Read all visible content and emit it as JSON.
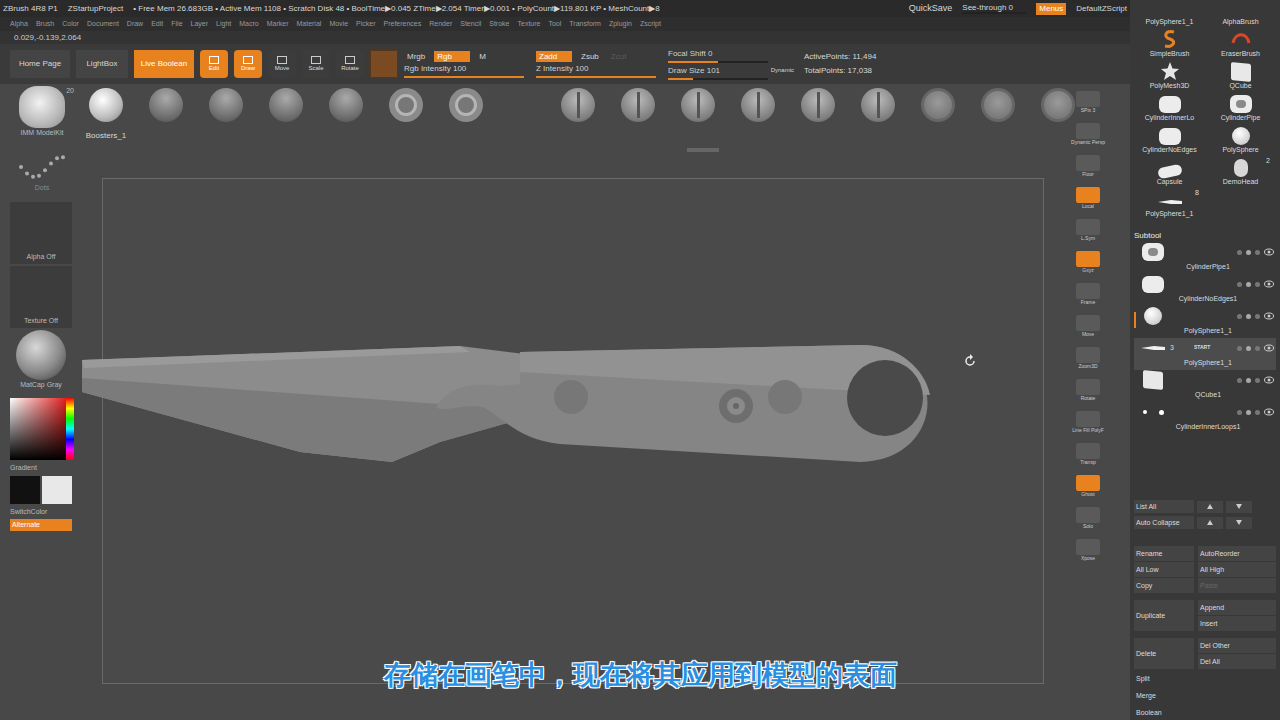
{
  "title_bar": {
    "app": "ZBrush 4R8 P1",
    "project": "ZStartupProject",
    "stats": "• Free Mem 26.683GB • Active Mem 1108 • Scratch Disk 48 • BoolTime▶0.045 ZTime▶2.054 Timer▶0.001 • PolyCount▶119.801 KP • MeshCount▶8",
    "quicksave": "QuickSave",
    "see_through": {
      "label": "See-through",
      "value": "0",
      "level": 0
    },
    "menus": {
      "label": "Menus",
      "on": true
    },
    "script": "DefaultZScript"
  },
  "menu": [
    "Alpha",
    "Brush",
    "Color",
    "Document",
    "Draw",
    "Edit",
    "File",
    "Layer",
    "Light",
    "Macro",
    "Marker",
    "Material",
    "Movie",
    "Picker",
    "Preferences",
    "Render",
    "Stencil",
    "Stroke",
    "Texture",
    "Tool",
    "Transform",
    "Zplugin",
    "Zscript"
  ],
  "coords": "0.029,-0.139,2.064",
  "shelf": {
    "home": "Home Page",
    "lightbox": "LightBox",
    "live_boolean": {
      "label": "Live Boolean",
      "on": true
    },
    "modes": [
      {
        "label": "Edit",
        "on": true
      },
      {
        "label": "Draw",
        "on": true
      },
      {
        "label": "Move",
        "on": false
      },
      {
        "label": "Scale",
        "on": false
      },
      {
        "label": "Rotate",
        "on": false
      }
    ],
    "color_modes": [
      {
        "label": "Mrgb",
        "on": false
      },
      {
        "label": "Rgb",
        "on": true
      },
      {
        "label": "M",
        "on": false
      }
    ],
    "rgb_intensity": {
      "label": "Rgb Intensity",
      "value": "100",
      "level": 1
    },
    "z_modes": [
      {
        "label": "Zadd",
        "on": true,
        "disabled": false
      },
      {
        "label": "Zsub",
        "on": false,
        "disabled": false
      },
      {
        "label": "Zcut",
        "on": false,
        "disabled": true
      }
    ],
    "z_intensity": {
      "label": "Z Intensity",
      "value": "100",
      "level": 1
    },
    "focal_shift": {
      "label": "Focal Shift",
      "value": "0",
      "level": 0.5
    },
    "draw_size": {
      "label": "Draw Size",
      "value": "101",
      "level": 0.25
    },
    "dynamic": "Dynamic",
    "active_points": "ActivePoints: 11,494",
    "total_points": "TotalPoints: 17,038"
  },
  "brush_shelf": {
    "label": "Boosters_1",
    "left_items": [
      {
        "kind": "ball"
      },
      {
        "kind": "stud"
      },
      {
        "kind": "stud"
      },
      {
        "kind": "stud"
      },
      {
        "kind": "stud"
      },
      {
        "kind": "ring"
      },
      {
        "kind": "ring"
      }
    ],
    "right_items": [
      {
        "kind": "screw"
      },
      {
        "kind": "screw"
      },
      {
        "kind": "screw"
      },
      {
        "kind": "screw"
      },
      {
        "kind": "screw"
      },
      {
        "kind": "screw"
      },
      {
        "kind": "disc"
      },
      {
        "kind": "disc"
      },
      {
        "kind": "disc"
      }
    ]
  },
  "left_panel": {
    "modelkit": {
      "label": "IMM ModelKit",
      "count": "20"
    },
    "stroke": "Dots",
    "alpha": "Alpha Off",
    "texture": "Texture Off",
    "material": "MatCap Gray",
    "gradient": "Gradient",
    "switch_color": "SwitchColor",
    "alternate": {
      "label": "Alternate",
      "on": true
    }
  },
  "right_shelf": [
    {
      "label": "SPix 3",
      "on": false
    },
    {
      "label": "Dynamic Persp",
      "on": false
    },
    {
      "label": "Floor",
      "on": false
    },
    {
      "label": "Local",
      "on": true
    },
    {
      "label": "L.Sym",
      "on": false
    },
    {
      "label": "Gxyz",
      "on": true
    },
    {
      "label": "Frame",
      "on": false
    },
    {
      "label": "Move",
      "on": false
    },
    {
      "label": "Zoom3D",
      "on": false
    },
    {
      "label": "Rotate",
      "on": false
    },
    {
      "label": "Line Fill PolyF",
      "on": false
    },
    {
      "label": "Transp",
      "on": false
    },
    {
      "label": "Ghost",
      "on": true
    },
    {
      "label": "Solo",
      "on": false
    },
    {
      "label": "Xpose",
      "on": false
    }
  ],
  "tools": [
    {
      "label": "PolySphere1_1",
      "kind": "none"
    },
    {
      "label": "AlphaBrush",
      "kind": "none"
    },
    {
      "label": "SimpleBrush",
      "kind": "brush"
    },
    {
      "label": "EraserBrush",
      "kind": "eraser"
    },
    {
      "label": "PolyMesh3D",
      "kind": "star"
    },
    {
      "label": "QCube",
      "kind": "cube"
    },
    {
      "label": "CylinderInnerLo",
      "kind": "cylinder"
    },
    {
      "label": "CylinderPipe",
      "kind": "pipe"
    },
    {
      "label": "CylinderNoEdges",
      "kind": "cylinder"
    },
    {
      "label": "PolySphere",
      "kind": "sphere"
    },
    {
      "label": "Capsule",
      "kind": "capsule"
    },
    {
      "label": "DemoHead",
      "kind": "head",
      "count": "2"
    },
    {
      "label": "PolySphere1_1",
      "kind": "knife",
      "count": "8"
    }
  ],
  "subtool": {
    "title": "Subtool",
    "items": [
      {
        "name": "CylinderPipe1",
        "kind": "pipe",
        "selected": false,
        "marked": false
      },
      {
        "name": "CylinderNoEdges1",
        "kind": "cylinder",
        "selected": false,
        "marked": false
      },
      {
        "name": "PolySphere1_1",
        "kind": "sphere",
        "selected": false,
        "marked": true
      },
      {
        "name": "PolySphere1_1",
        "kind": "knife",
        "selected": true,
        "marked": false,
        "count": "3",
        "badge": "START"
      },
      {
        "name": "QCube1",
        "kind": "cube",
        "selected": false,
        "marked": false
      },
      {
        "name": "CylinderInnerLoops1",
        "kind": "dots",
        "selected": false,
        "marked": false
      }
    ]
  },
  "list_controls": [
    "List All",
    "Auto Collapse"
  ],
  "action_rows": [
    {
      "left": "Rename",
      "right": [
        {
          "label": "AutoReorder",
          "disabled": false
        }
      ]
    },
    {
      "left": "All Low",
      "right": [
        {
          "label": "All High",
          "disabled": false
        }
      ]
    },
    {
      "left": "Copy",
      "right": [
        {
          "label": "Paste",
          "disabled": true
        }
      ]
    },
    {
      "left": "Duplicate",
      "right": [
        {
          "label": "Append",
          "disabled": false
        },
        {
          "label": "Insert",
          "disabled": false
        }
      ]
    },
    {
      "left": "Delete",
      "right": [
        {
          "label": "Del Other",
          "disabled": false
        },
        {
          "label": "Del All",
          "disabled": false
        }
      ]
    }
  ],
  "extra_actions": [
    "Split",
    "Merge",
    "Boolean"
  ],
  "subtitle": "存储在画笔中，现在将其应用到模型的表面"
}
